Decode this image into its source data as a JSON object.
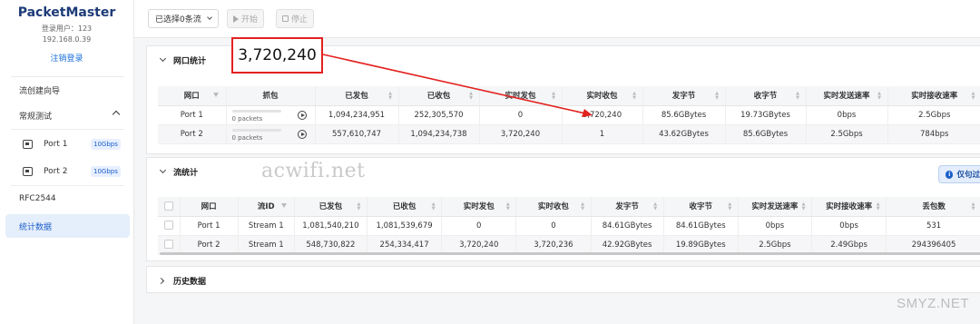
{
  "sidebar": {
    "brand": "PacketMaster",
    "user_line": "登录用户：123",
    "ip": "192.168.0.39",
    "logout": "注销登录",
    "items": [
      {
        "label": "流创建向导"
      },
      {
        "label": "常规测试"
      },
      {
        "label": "Port 1",
        "badge": "10Gbps"
      },
      {
        "label": "Port 2",
        "badge": "10Gbps"
      },
      {
        "label": "RFC2544"
      },
      {
        "label": "统计数据"
      }
    ]
  },
  "toolbar": {
    "selection": "已选择0条流",
    "start": "开始",
    "stop": "停止"
  },
  "port_stats": {
    "title": "网口统计",
    "headers": [
      "网口",
      "抓包",
      "已发包",
      "已收包",
      "实时发包",
      "实时收包",
      "发字节",
      "收字节",
      "实时发送速率",
      "实时接收速率"
    ],
    "rows": [
      {
        "port": "Port 1",
        "capture": "0 packets",
        "sent": "1,094,234,951",
        "received": "252,305,570",
        "rt_sent": "0",
        "rt_recv": "3,720,240",
        "tx_bytes": "85.6GBytes",
        "rx_bytes": "19.73GBytes",
        "tx_rate": "0bps",
        "rx_rate": "2.5Gbps"
      },
      {
        "port": "Port 2",
        "capture": "0 packets",
        "sent": "557,610,747",
        "received": "1,094,234,738",
        "rt_sent": "3,720,240",
        "rt_recv": "1",
        "tx_bytes": "43.62GBytes",
        "rx_bytes": "85.6GBytes",
        "tx_rate": "2.5Gbps",
        "rx_rate": "784bps"
      }
    ]
  },
  "flow_stats": {
    "title": "流统计",
    "only_button": "仅句过",
    "headers": [
      "网口",
      "流ID",
      "已发包",
      "已收包",
      "实时发包",
      "实时收包",
      "发字节",
      "收字节",
      "实时发送速率",
      "实时接收速率",
      "丢包数"
    ],
    "rows": [
      {
        "port": "Port 1",
        "flow": "Stream 1",
        "sent": "1,081,540,210",
        "received": "1,081,539,679",
        "rt_sent": "0",
        "rt_recv": "0",
        "tx_bytes": "84.61GBytes",
        "rx_bytes": "84.61GBytes",
        "tx_rate": "0bps",
        "rx_rate": "0bps",
        "lost": "531"
      },
      {
        "port": "Port 2",
        "flow": "Stream 1",
        "sent": "548,730,822",
        "received": "254,334,417",
        "rt_sent": "3,720,240",
        "rt_recv": "3,720,236",
        "tx_bytes": "42.92GBytes",
        "rx_bytes": "19.89GBytes",
        "tx_rate": "2.5Gbps",
        "rx_rate": "2.49Gbps",
        "lost": "294396405"
      }
    ]
  },
  "history": {
    "title": "历史数据"
  },
  "annotation": {
    "callout": "3,720,240",
    "color": "#e2221f"
  },
  "watermarks": {
    "center": "acwifi.net",
    "corner": "SMYZ.NET"
  }
}
